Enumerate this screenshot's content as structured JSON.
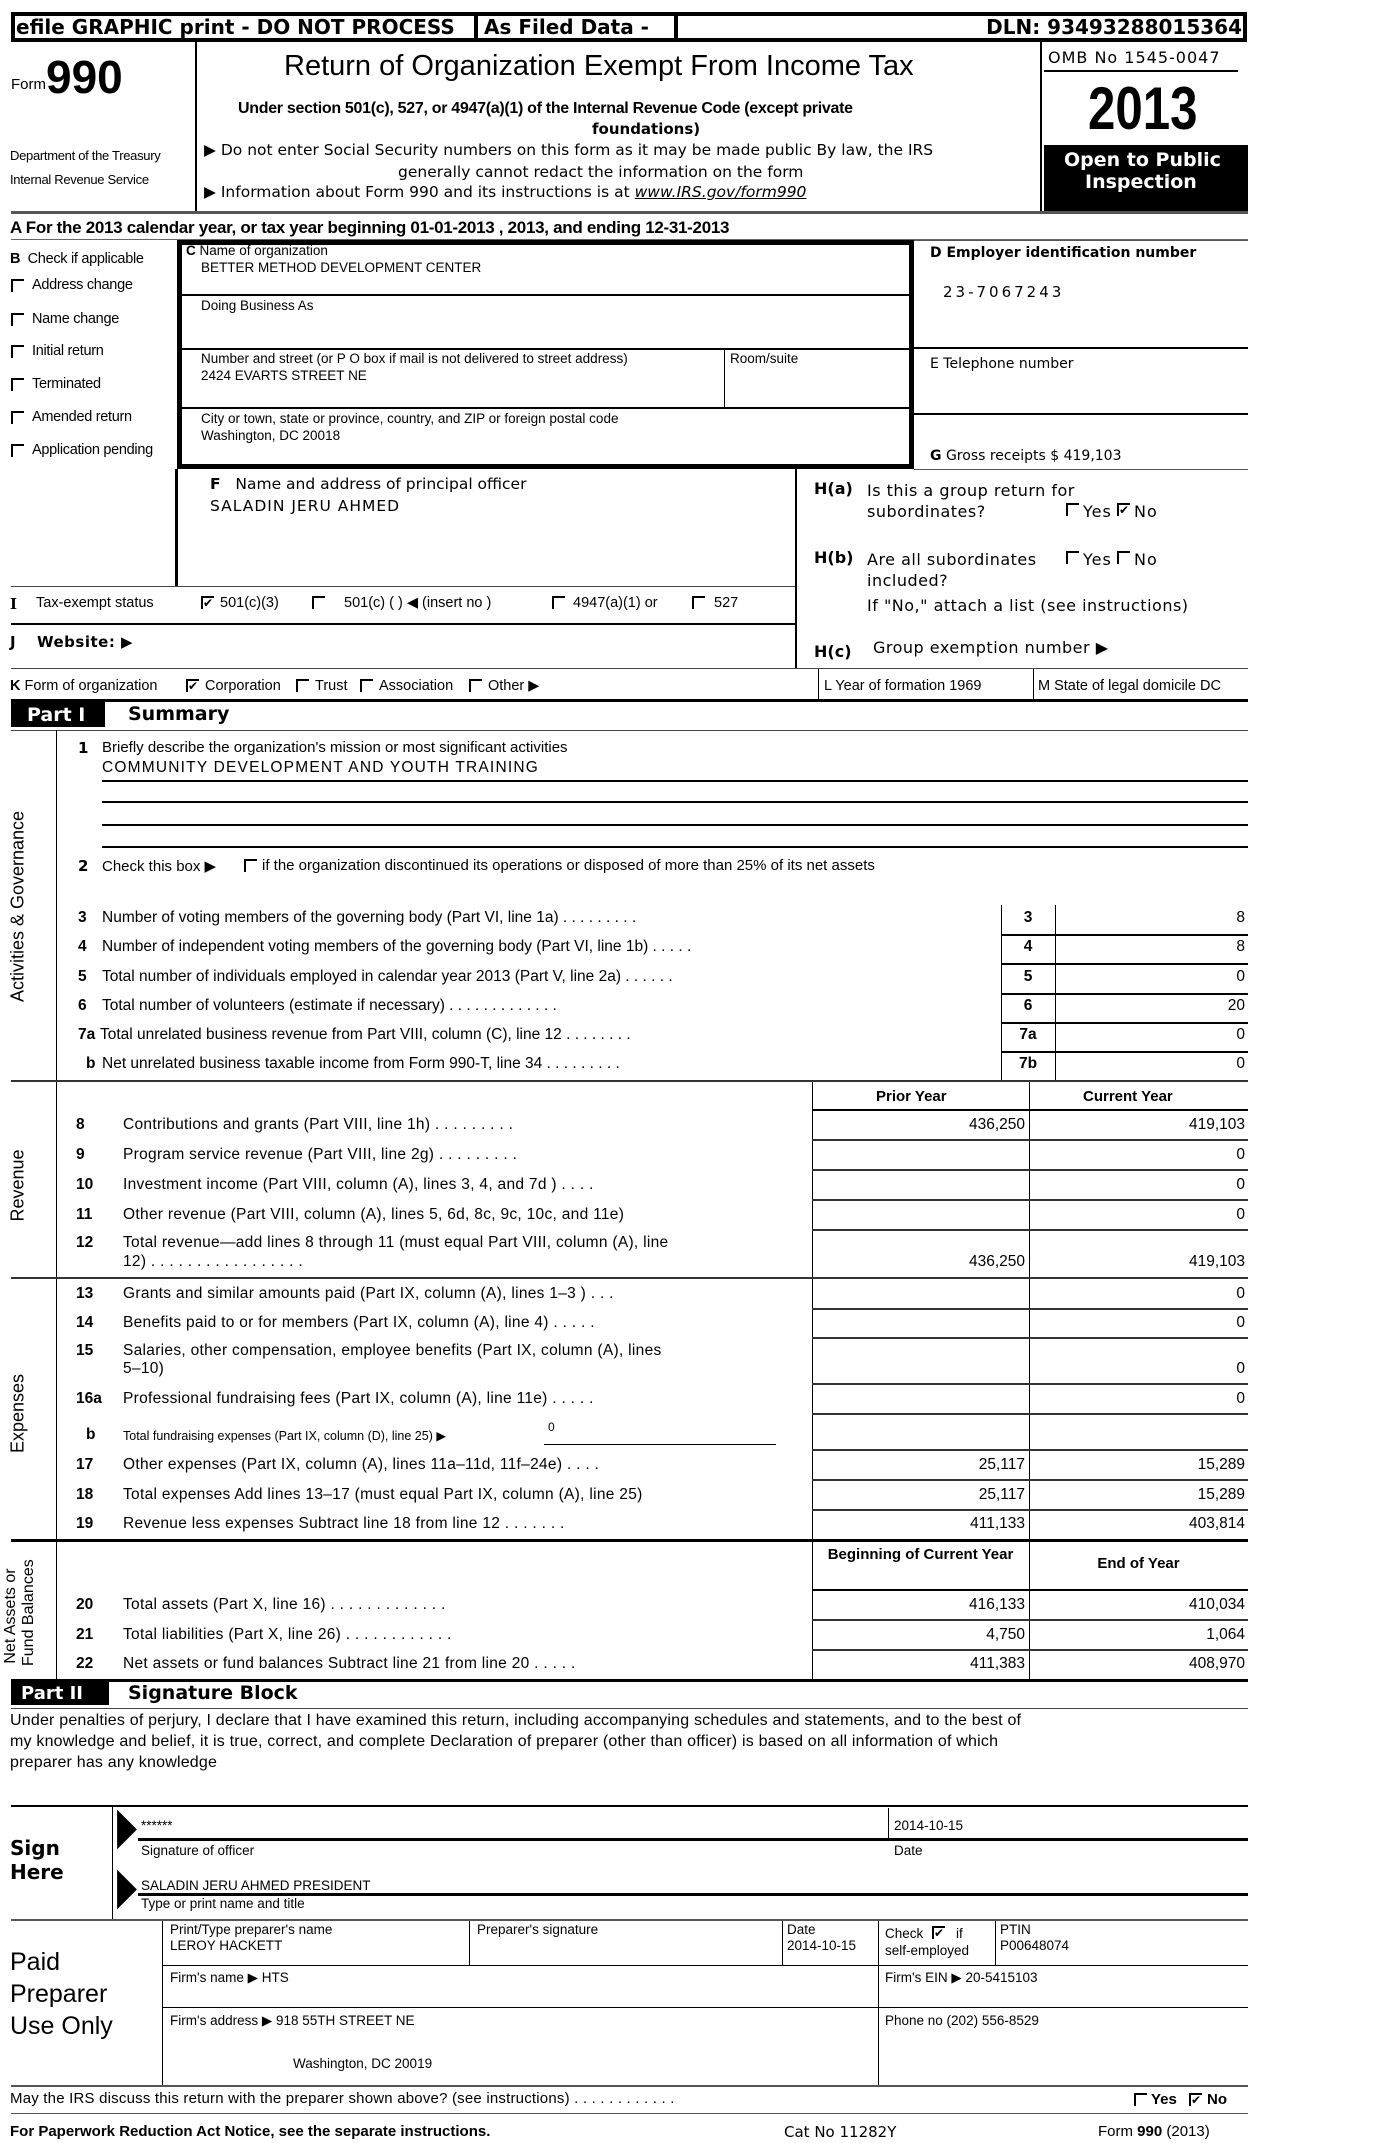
{
  "header": {
    "efile_banner": "efile GRAPHIC print - DO NOT PROCESS",
    "as_filed": "As Filed Data -",
    "dln": "DLN: 93493288015364",
    "form_prefix": "Form",
    "form_number": "990",
    "dept_line1": "Department of the Treasury",
    "dept_line2": "Internal Revenue Service",
    "title": "Return of Organization Exempt From Income Tax",
    "subtitle_line1": "Under section 501(c), 527, or 4947(a)(1) of the Internal Revenue Code (except private",
    "subtitle_line2": "foundations)",
    "notice1_line1": "Do not enter Social Security numbers on this form as it may be made public  By law, the IRS",
    "notice1_line2": "generally cannot redact the information on the form",
    "notice2_prefix": "Information about Form 990 and its instructions is at ",
    "notice2_link": "www.IRS.gov/form990",
    "omb": "OMB No 1545-0047",
    "year": "2013",
    "open_public_line1": "Open to Public",
    "open_public_line2": "Inspection"
  },
  "line_a": "A  For the 2013 calendar year, or tax year beginning 01-01-2013     , 2013, and ending 12-31-2013",
  "section_b": {
    "label": "B  Check if applicable",
    "items": [
      {
        "label": "Address change",
        "checked": false
      },
      {
        "label": "Name change",
        "checked": false
      },
      {
        "label": "Initial return",
        "checked": false
      },
      {
        "label": "Terminated",
        "checked": false
      },
      {
        "label": "Amended return",
        "checked": false
      },
      {
        "label": "Application pending",
        "checked": false
      }
    ]
  },
  "section_c": {
    "name_label": "C Name of organization",
    "name_value": "BETTER METHOD DEVELOPMENT CENTER",
    "dba_label": "Doing Business As",
    "street_label": "Number and street (or P O  box if mail is not delivered to street address)",
    "street_value": "2424 EVARTS STREET NE",
    "room_label": "Room/suite",
    "city_label": "City or town, state or province, country, and ZIP or foreign postal code",
    "city_value": "Washington, DC  20018"
  },
  "section_d": {
    "label": "D Employer identification number",
    "value": "23-7067243"
  },
  "section_e": {
    "label": "E Telephone number"
  },
  "section_g": {
    "label_letter": "G",
    "label": "Gross receipts $ 419,103"
  },
  "section_f": {
    "letter": "F",
    "label": "Name and address of principal officer",
    "value": "SALADIN JERU AHMED"
  },
  "section_h": {
    "ha_code": "H(a)",
    "ha_line1": "Is this a group return for",
    "ha_line2": "subordinates?",
    "ha_yes": "Yes",
    "ha_no": "No",
    "ha_yes_checked": false,
    "ha_no_checked": true,
    "hb_code": "H(b)",
    "hb_line1": "Are all subordinates",
    "hb_line2": "included?",
    "hb_yes": "Yes",
    "hb_no": "No",
    "hb_yes_checked": false,
    "hb_no_checked": false,
    "hb_note": "If \"No,\" attach a list  (see instructions)",
    "hc_code": "H(c)",
    "hc_label": "Group exemption number ▶"
  },
  "section_i": {
    "letter": "I",
    "label": "Tax-exempt status",
    "opt1": "501(c)(3)",
    "opt1_checked": true,
    "opt2": "501(c) (   ) ◀ (insert no )",
    "opt2_checked": false,
    "opt3": "4947(a)(1) or",
    "opt3_checked": false,
    "opt4": "527",
    "opt4_checked": false
  },
  "section_j": {
    "letter": "J",
    "label": "Website: ▶"
  },
  "section_k": {
    "label": "K Form of organization",
    "opts": [
      {
        "label": "Corporation",
        "checked": true
      },
      {
        "label": "Trust",
        "checked": false
      },
      {
        "label": "Association",
        "checked": false
      },
      {
        "label": "Other ▶",
        "checked": false
      }
    ]
  },
  "section_l": {
    "label": "L Year of formation  1969"
  },
  "section_m": {
    "label": "M State of legal domicile  DC"
  },
  "part1": {
    "tag": "Part I",
    "title": "Summary",
    "side_labels": {
      "activities": "Activities & Governance",
      "revenue": "Revenue",
      "expenses": "Expenses",
      "net_assets_line1": "Net Assets or",
      "net_assets_line2": "Fund Balances"
    },
    "line1_num": "1",
    "line1_label": "Briefly describe the organization's mission or most significant activities",
    "line1_value": "COMMUNITY DEVELOPMENT AND YOUTH TRAINING",
    "line2_num": "2",
    "line2_label": "Check this box ▶",
    "line2_rest": "if the organization discontinued its operations or disposed of more than 25% of its net assets",
    "gov_lines": [
      {
        "num": "3",
        "label": "Number of voting members of the governing body (Part VI, line 1a)  .  .  .  .  .  .  .  .  .",
        "box": "3",
        "value": "8"
      },
      {
        "num": "4",
        "label": "Number of independent voting members of the governing body (Part VI, line 1b)  .  .  .  .  .",
        "box": "4",
        "value": "8"
      },
      {
        "num": "5",
        "label": "Total number of individuals employed in calendar year 2013 (Part V, line 2a)  .  .  .  .  .  .",
        "box": "5",
        "value": "0"
      },
      {
        "num": "6",
        "label": "Total number of volunteers (estimate if necessary)  .  .  .  .  .  .  .  .  .  .  .  .  .",
        "box": "6",
        "value": "20"
      },
      {
        "num": "7a",
        "label": "Total unrelated business revenue from Part VIII, column (C), line 12  .  .  .  .  .  .  .  .",
        "box": "7a",
        "value": "0"
      },
      {
        "num": "b",
        "label": "Net unrelated business taxable income from Form 990-T, line 34  .  .  .  .  .  .  .  .  .",
        "box": "7b",
        "value": "0"
      }
    ],
    "col_prior": "Prior Year",
    "col_current": "Current Year",
    "revenue_lines": [
      {
        "num": "8",
        "label": "Contributions and grants (Part VIII, line 1h)  .  .  .  .  .  .  .  .  .",
        "prior": "436,250",
        "current": "419,103"
      },
      {
        "num": "9",
        "label": "Program service revenue (Part VIII, line 2g)  .  .  .  .  .  .  .  .  .",
        "prior": "",
        "current": "0"
      },
      {
        "num": "10",
        "label": "Investment income (Part VIII, column (A), lines 3, 4, and 7d )  .  .  .  .",
        "prior": "",
        "current": "0"
      },
      {
        "num": "11",
        "label": "Other revenue (Part VIII, column (A), lines 5, 6d, 8c, 9c, 10c, and 11e)",
        "prior": "",
        "current": "0"
      },
      {
        "num": "12",
        "label": "Total revenue—add lines 8 through 11 (must equal Part VIII, column (A), line",
        "label2": "12)  .  .  .  .  .  .  .  .  .  .  .  .  .  .  .  .  .",
        "prior": "436,250",
        "current": "419,103"
      }
    ],
    "expense_lines": [
      {
        "num": "13",
        "label": "Grants and similar amounts paid (Part IX, column (A), lines 1–3 )  .  .  .",
        "prior": "",
        "current": "0"
      },
      {
        "num": "14",
        "label": "Benefits paid to or for members (Part IX, column (A), line 4)  .  .  .  .  .",
        "prior": "",
        "current": "0"
      },
      {
        "num": "15",
        "label": "Salaries, other compensation, employee benefits (Part IX, column (A), lines",
        "label2": "5–10)",
        "prior": "",
        "current": "0"
      },
      {
        "num": "16a",
        "label": "Professional fundraising fees (Part IX, column (A), line 11e)  .  .  .  .  .",
        "prior": "",
        "current": "0"
      },
      {
        "num": "b",
        "label": "Total fundraising expenses (Part IX, column (D), line 25) ▶",
        "inline_value": "0",
        "prior": "",
        "current": ""
      },
      {
        "num": "17",
        "label": "Other expenses (Part IX, column (A), lines 11a–11d, 11f–24e)  .  .  .  .",
        "prior": "25,117",
        "current": "15,289"
      },
      {
        "num": "18",
        "label": "Total expenses  Add lines 13–17 (must equal Part IX, column (A), line 25)",
        "prior": "25,117",
        "current": "15,289"
      },
      {
        "num": "19",
        "label": "Revenue less expenses  Subtract line 18 from line 12  .  .  .  .  .  .  .",
        "prior": "411,133",
        "current": "403,814"
      }
    ],
    "col_beginning": "Beginning of Current Year",
    "col_end": "End of Year",
    "net_lines": [
      {
        "num": "20",
        "label": "Total assets (Part X, line 16)  .  .  .  .  .  .  .  .  .  .  .  .  .",
        "begin": "416,133",
        "end": "410,034"
      },
      {
        "num": "21",
        "label": "Total liabilities (Part X, line 26)  .  .  .  .  .  .  .  .  .  .  .  .",
        "begin": "4,750",
        "end": "1,064"
      },
      {
        "num": "22",
        "label": "Net assets or fund balances  Subtract line 21 from line 20  .  .  .  .  .",
        "begin": "411,383",
        "end": "408,970"
      }
    ]
  },
  "part2": {
    "tag": "Part II",
    "title": "Signature Block",
    "declaration_line1": "Under penalties of perjury, I declare that I have examined this return, including accompanying schedules and statements, and to the best of",
    "declaration_line2": "my knowledge and belief, it is true, correct, and complete  Declaration of preparer (other than officer) is based on all information of which",
    "declaration_line3": "preparer has any knowledge",
    "sign_here_line1": "Sign",
    "sign_here_line2": "Here",
    "signature_value": "******",
    "signature_label": "Signature of officer",
    "sign_date_value": "2014-10-15",
    "sign_date_label": "Date",
    "name_title_value": "SALADIN JERU AHMED PRESIDENT",
    "name_title_label": "Type or print name and title"
  },
  "preparer": {
    "section_line1": "Paid",
    "section_line2": "Preparer",
    "section_line3": "Use Only",
    "name_label": "Print/Type preparer's name",
    "name_value": "LEROY HACKETT",
    "sig_label": "Preparer's signature",
    "date_label": "Date",
    "date_value": "2014-10-15",
    "check_label": "Check",
    "check_label2": "if",
    "check_label3": "self-employed",
    "self_employed_checked": true,
    "ptin_label": "PTIN",
    "ptin_value": "P00648074",
    "firm_name_label": "Firm's name   ▶ HTS",
    "firm_ein_label": "Firm's EIN ▶ 20-5415103",
    "firm_address_label": "Firm's address ▶ 918 55TH STREET NE",
    "firm_address_line2": "Washington, DC  20019",
    "phone_label": "Phone no  (202) 556-8529"
  },
  "discuss": {
    "question": "May the IRS discuss this return with the preparer shown above? (see instructions)  .  .  .  .  .  .  .  .  .  .  .  .",
    "yes": "Yes",
    "no": "No",
    "yes_checked": false,
    "no_checked": true
  },
  "footer": {
    "paperwork": "For Paperwork Reduction Act Notice, see the separate instructions.",
    "cat_no": "Cat No 11282Y",
    "form_ref_prefix": "Form ",
    "form_ref_num": "990",
    "form_ref_suffix": " (2013)"
  }
}
